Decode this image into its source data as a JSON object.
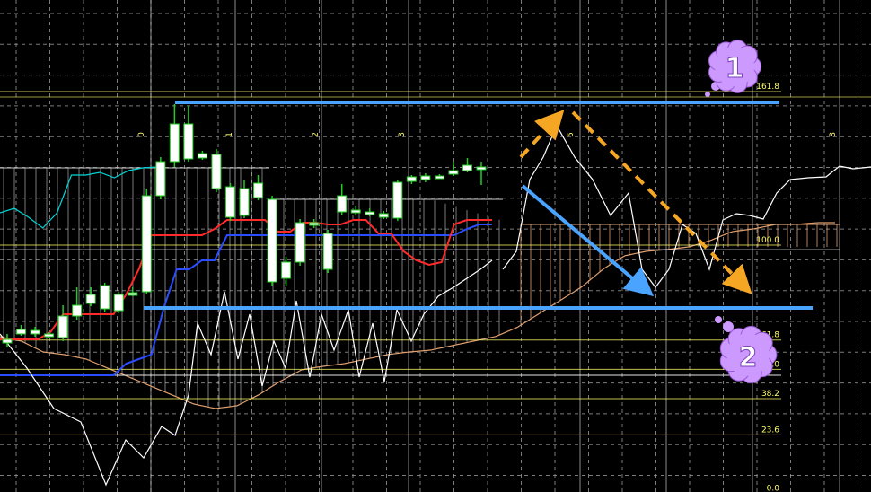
{
  "chart_data": {
    "type": "candlestick-ichimoku",
    "title": "",
    "xlabel": "",
    "ylabel": "",
    "colors": {
      "background": "#000000",
      "grid": "#9a9a9a",
      "candle_up": "#ffffff",
      "candle_down": "#ffffff",
      "candle_wick": "#22cc22",
      "tenkan": "#ff2a2a",
      "kijun": "#2a4dff",
      "chikou": "#ffffff",
      "senkou_a": "#c8c8c8",
      "senkou_b": "#e0a070",
      "kumo_lines": "#dddddd",
      "fib": "#ffff66",
      "trend_blue": "#4aa3ff",
      "trend_orange": "#f5a623",
      "bubble": "#cc99ff",
      "cyan_line": "#00d6d6"
    },
    "wave_labels": [
      "0",
      "1",
      "2",
      "3",
      "5",
      "8"
    ],
    "fib_levels": [
      {
        "label": "161.8",
        "value": 161.8
      },
      {
        "label": "100.0",
        "value": 100.0
      },
      {
        "label": "61.8",
        "value": 61.8
      },
      {
        "label": "50.0",
        "value": 50.0
      },
      {
        "label": "38.2",
        "value": 38.2
      },
      {
        "label": "23.6",
        "value": 23.6
      },
      {
        "label": "0.0",
        "value": 0.0
      }
    ],
    "candles": [
      {
        "o": 378,
        "c": 382,
        "h": 387,
        "l": 372
      },
      {
        "o": 372,
        "c": 367,
        "h": 374,
        "l": 362
      },
      {
        "o": 368,
        "c": 372,
        "h": 375,
        "l": 364
      },
      {
        "o": 372,
        "c": 373,
        "h": 376,
        "l": 370
      },
      {
        "o": 376,
        "c": 352,
        "h": 380,
        "l": 340
      },
      {
        "o": 352,
        "c": 340,
        "h": 356,
        "l": 320
      },
      {
        "o": 338,
        "c": 328,
        "h": 341,
        "l": 320
      },
      {
        "o": 318,
        "c": 344,
        "h": 348,
        "l": 315
      },
      {
        "o": 346,
        "c": 328,
        "h": 349,
        "l": 325
      },
      {
        "o": 328,
        "c": 326,
        "h": 330,
        "l": 320
      },
      {
        "o": 325,
        "c": 218,
        "h": 328,
        "l": 210
      },
      {
        "o": 218,
        "c": 180,
        "h": 222,
        "l": 175
      },
      {
        "o": 180,
        "c": 138,
        "h": 186,
        "l": 116
      },
      {
        "o": 138,
        "c": 177,
        "h": 180,
        "l": 118
      },
      {
        "o": 176,
        "c": 171,
        "h": 178,
        "l": 168
      },
      {
        "o": 172,
        "c": 210,
        "h": 214,
        "l": 166
      },
      {
        "o": 208,
        "c": 242,
        "h": 246,
        "l": 204
      },
      {
        "o": 240,
        "c": 210,
        "h": 243,
        "l": 200
      },
      {
        "o": 204,
        "c": 220,
        "h": 223,
        "l": 195
      },
      {
        "o": 222,
        "c": 314,
        "h": 318,
        "l": 218
      },
      {
        "o": 310,
        "c": 292,
        "h": 318,
        "l": 286
      },
      {
        "o": 292,
        "c": 248,
        "h": 296,
        "l": 244
      },
      {
        "o": 248,
        "c": 250,
        "h": 254,
        "l": 244
      },
      {
        "o": 260,
        "c": 300,
        "h": 304,
        "l": 256
      },
      {
        "o": 236,
        "c": 218,
        "h": 240,
        "l": 205
      },
      {
        "o": 236,
        "c": 234,
        "h": 240,
        "l": 230
      },
      {
        "o": 238,
        "c": 236,
        "h": 241,
        "l": 232
      },
      {
        "o": 242,
        "c": 238,
        "h": 244,
        "l": 235
      },
      {
        "o": 243,
        "c": 203,
        "h": 246,
        "l": 200
      },
      {
        "o": 202,
        "c": 197,
        "h": 205,
        "l": 195
      },
      {
        "o": 200,
        "c": 196,
        "h": 203,
        "l": 193
      },
      {
        "o": 197,
        "c": 196,
        "h": 199,
        "l": 194
      },
      {
        "o": 194,
        "c": 190,
        "h": 196,
        "l": 180
      },
      {
        "o": 190,
        "c": 184,
        "h": 192,
        "l": 176
      },
      {
        "o": 186,
        "c": 187,
        "h": 206,
        "l": 180
      }
    ],
    "tenkan": [
      378,
      378,
      378,
      378,
      370,
      350,
      350,
      350,
      350,
      350,
      328,
      300,
      262,
      262,
      262,
      262,
      262,
      255,
      245,
      245,
      245,
      245,
      258,
      258,
      248,
      248,
      250,
      250,
      245,
      245,
      260,
      260,
      280,
      290,
      295,
      292,
      250,
      245,
      245,
      245
    ],
    "kijun": [
      418,
      418,
      418,
      418,
      418,
      418,
      418,
      418,
      418,
      418,
      405,
      400,
      395,
      342,
      300,
      300,
      290,
      290,
      262,
      262,
      262,
      262,
      262,
      262,
      262,
      262,
      262,
      262,
      262,
      262,
      262,
      262,
      262,
      262,
      262,
      262,
      262,
      255,
      250,
      250
    ],
    "chikou_x": [
      0,
      30,
      60,
      90,
      118,
      140,
      160,
      180,
      195,
      210,
      220,
      235,
      250,
      265,
      278,
      292,
      305,
      318,
      330,
      345,
      358,
      372,
      388,
      400,
      415,
      428,
      442,
      458,
      472,
      488,
      505,
      520,
      535,
      548
    ],
    "chikou_y": [
      372,
      410,
      455,
      470,
      540,
      490,
      510,
      475,
      485,
      440,
      360,
      395,
      325,
      400,
      350,
      430,
      380,
      410,
      335,
      420,
      350,
      390,
      345,
      420,
      360,
      425,
      345,
      380,
      350,
      330,
      320,
      310,
      300,
      290
    ],
    "future_white_x": [
      560,
      575,
      590,
      605,
      620,
      640,
      660,
      680,
      700,
      715,
      730,
      745,
      760,
      775,
      790,
      805,
      820,
      835,
      850,
      865,
      880,
      900,
      920,
      935,
      950,
      970
    ],
    "future_white_y": [
      300,
      280,
      200,
      175,
      140,
      175,
      200,
      240,
      215,
      300,
      320,
      300,
      250,
      260,
      300,
      245,
      238,
      240,
      244,
      215,
      200,
      198,
      197,
      185,
      188,
      186
    ],
    "cyan_y": [
      237,
      232,
      242,
      254,
      237,
      195,
      195,
      192,
      198,
      190,
      187,
      186
    ],
    "senkou_b_y": [
      375,
      380,
      392,
      395,
      400,
      410,
      420,
      430,
      440,
      450,
      455,
      452,
      440,
      425,
      412,
      408,
      405,
      400,
      395,
      392,
      390,
      385,
      380,
      375,
      365,
      350,
      335,
      320,
      300,
      285,
      280,
      278,
      275,
      268,
      258,
      255,
      250,
      250,
      248,
      248
    ],
    "fib_line_values": [
      100.0,
      61.8,
      50.0
    ]
  },
  "annotations": {
    "bubble_1": "1",
    "bubble_2": "2"
  }
}
